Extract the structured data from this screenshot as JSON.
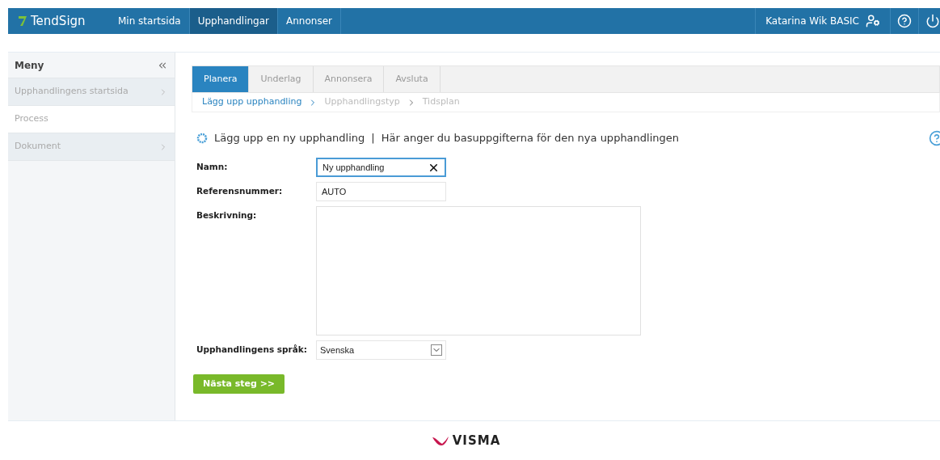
{
  "header": {
    "brand": "TendSign",
    "nav": [
      {
        "label": "Min startsida",
        "selected": false
      },
      {
        "label": "Upphandlingar",
        "selected": true
      },
      {
        "label": "Annonser",
        "selected": false
      }
    ],
    "user": "Katarina Wik BASIC"
  },
  "sidebar": {
    "title": "Meny",
    "items": [
      {
        "label": "Upphandlingens startsida",
        "selected": false,
        "has_children": true
      },
      {
        "label": "Process",
        "selected": true,
        "has_children": false
      },
      {
        "label": "Dokument",
        "selected": false,
        "has_children": true
      }
    ]
  },
  "steps": [
    {
      "label": "Planera",
      "selected": true
    },
    {
      "label": "Underlag",
      "selected": false
    },
    {
      "label": "Annonsera",
      "selected": false
    },
    {
      "label": "Avsluta",
      "selected": false
    }
  ],
  "substeps": [
    {
      "label": "Lägg upp upphandling",
      "selected": true
    },
    {
      "label": "Upphandlingstyp",
      "selected": false
    },
    {
      "label": "Tidsplan",
      "selected": false
    }
  ],
  "heading": {
    "title": "Lägg upp en ny upphandling",
    "separator": "|",
    "subtitle": "Här anger du basuppgifterna för den nya upphandlingen"
  },
  "form": {
    "fields": [
      {
        "kind": "text",
        "label": "Namn:",
        "value": "Ny upphandling",
        "focused": true
      },
      {
        "kind": "text",
        "label": "Referensnummer:",
        "value": "AUTO",
        "focused": false
      },
      {
        "kind": "textarea",
        "label": "Beskrivning:"
      },
      {
        "kind": "select",
        "label": "Upphandlingens språk:",
        "value": "Svenska"
      }
    ],
    "submit": "Nästa steg >>"
  },
  "footer": {
    "logo": "VISMA"
  }
}
